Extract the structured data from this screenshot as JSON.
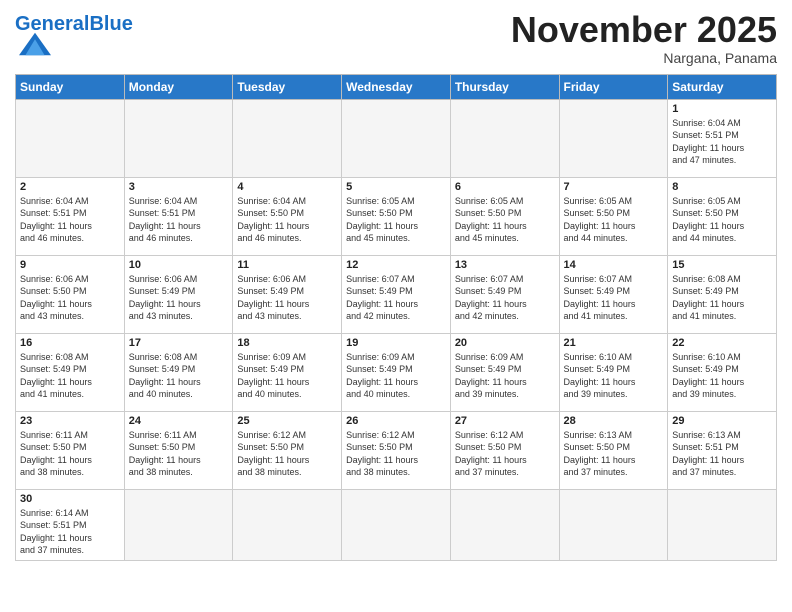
{
  "header": {
    "logo_general": "General",
    "logo_blue": "Blue",
    "month_title": "November 2025",
    "subtitle": "Nargana, Panama"
  },
  "weekdays": [
    "Sunday",
    "Monday",
    "Tuesday",
    "Wednesday",
    "Thursday",
    "Friday",
    "Saturday"
  ],
  "weeks": [
    [
      {
        "day": "",
        "info": ""
      },
      {
        "day": "",
        "info": ""
      },
      {
        "day": "",
        "info": ""
      },
      {
        "day": "",
        "info": ""
      },
      {
        "day": "",
        "info": ""
      },
      {
        "day": "",
        "info": ""
      },
      {
        "day": "1",
        "info": "Sunrise: 6:04 AM\nSunset: 5:51 PM\nDaylight: 11 hours\nand 47 minutes."
      }
    ],
    [
      {
        "day": "2",
        "info": "Sunrise: 6:04 AM\nSunset: 5:51 PM\nDaylight: 11 hours\nand 46 minutes."
      },
      {
        "day": "3",
        "info": "Sunrise: 6:04 AM\nSunset: 5:51 PM\nDaylight: 11 hours\nand 46 minutes."
      },
      {
        "day": "4",
        "info": "Sunrise: 6:04 AM\nSunset: 5:50 PM\nDaylight: 11 hours\nand 46 minutes."
      },
      {
        "day": "5",
        "info": "Sunrise: 6:05 AM\nSunset: 5:50 PM\nDaylight: 11 hours\nand 45 minutes."
      },
      {
        "day": "6",
        "info": "Sunrise: 6:05 AM\nSunset: 5:50 PM\nDaylight: 11 hours\nand 45 minutes."
      },
      {
        "day": "7",
        "info": "Sunrise: 6:05 AM\nSunset: 5:50 PM\nDaylight: 11 hours\nand 44 minutes."
      },
      {
        "day": "8",
        "info": "Sunrise: 6:05 AM\nSunset: 5:50 PM\nDaylight: 11 hours\nand 44 minutes."
      }
    ],
    [
      {
        "day": "9",
        "info": "Sunrise: 6:06 AM\nSunset: 5:50 PM\nDaylight: 11 hours\nand 43 minutes."
      },
      {
        "day": "10",
        "info": "Sunrise: 6:06 AM\nSunset: 5:49 PM\nDaylight: 11 hours\nand 43 minutes."
      },
      {
        "day": "11",
        "info": "Sunrise: 6:06 AM\nSunset: 5:49 PM\nDaylight: 11 hours\nand 43 minutes."
      },
      {
        "day": "12",
        "info": "Sunrise: 6:07 AM\nSunset: 5:49 PM\nDaylight: 11 hours\nand 42 minutes."
      },
      {
        "day": "13",
        "info": "Sunrise: 6:07 AM\nSunset: 5:49 PM\nDaylight: 11 hours\nand 42 minutes."
      },
      {
        "day": "14",
        "info": "Sunrise: 6:07 AM\nSunset: 5:49 PM\nDaylight: 11 hours\nand 41 minutes."
      },
      {
        "day": "15",
        "info": "Sunrise: 6:08 AM\nSunset: 5:49 PM\nDaylight: 11 hours\nand 41 minutes."
      }
    ],
    [
      {
        "day": "16",
        "info": "Sunrise: 6:08 AM\nSunset: 5:49 PM\nDaylight: 11 hours\nand 41 minutes."
      },
      {
        "day": "17",
        "info": "Sunrise: 6:08 AM\nSunset: 5:49 PM\nDaylight: 11 hours\nand 40 minutes."
      },
      {
        "day": "18",
        "info": "Sunrise: 6:09 AM\nSunset: 5:49 PM\nDaylight: 11 hours\nand 40 minutes."
      },
      {
        "day": "19",
        "info": "Sunrise: 6:09 AM\nSunset: 5:49 PM\nDaylight: 11 hours\nand 40 minutes."
      },
      {
        "day": "20",
        "info": "Sunrise: 6:09 AM\nSunset: 5:49 PM\nDaylight: 11 hours\nand 39 minutes."
      },
      {
        "day": "21",
        "info": "Sunrise: 6:10 AM\nSunset: 5:49 PM\nDaylight: 11 hours\nand 39 minutes."
      },
      {
        "day": "22",
        "info": "Sunrise: 6:10 AM\nSunset: 5:49 PM\nDaylight: 11 hours\nand 39 minutes."
      }
    ],
    [
      {
        "day": "23",
        "info": "Sunrise: 6:11 AM\nSunset: 5:50 PM\nDaylight: 11 hours\nand 38 minutes."
      },
      {
        "day": "24",
        "info": "Sunrise: 6:11 AM\nSunset: 5:50 PM\nDaylight: 11 hours\nand 38 minutes."
      },
      {
        "day": "25",
        "info": "Sunrise: 6:12 AM\nSunset: 5:50 PM\nDaylight: 11 hours\nand 38 minutes."
      },
      {
        "day": "26",
        "info": "Sunrise: 6:12 AM\nSunset: 5:50 PM\nDaylight: 11 hours\nand 38 minutes."
      },
      {
        "day": "27",
        "info": "Sunrise: 6:12 AM\nSunset: 5:50 PM\nDaylight: 11 hours\nand 37 minutes."
      },
      {
        "day": "28",
        "info": "Sunrise: 6:13 AM\nSunset: 5:50 PM\nDaylight: 11 hours\nand 37 minutes."
      },
      {
        "day": "29",
        "info": "Sunrise: 6:13 AM\nSunset: 5:51 PM\nDaylight: 11 hours\nand 37 minutes."
      }
    ],
    [
      {
        "day": "30",
        "info": "Sunrise: 6:14 AM\nSunset: 5:51 PM\nDaylight: 11 hours\nand 37 minutes."
      },
      {
        "day": "",
        "info": ""
      },
      {
        "day": "",
        "info": ""
      },
      {
        "day": "",
        "info": ""
      },
      {
        "day": "",
        "info": ""
      },
      {
        "day": "",
        "info": ""
      },
      {
        "day": "",
        "info": ""
      }
    ]
  ]
}
